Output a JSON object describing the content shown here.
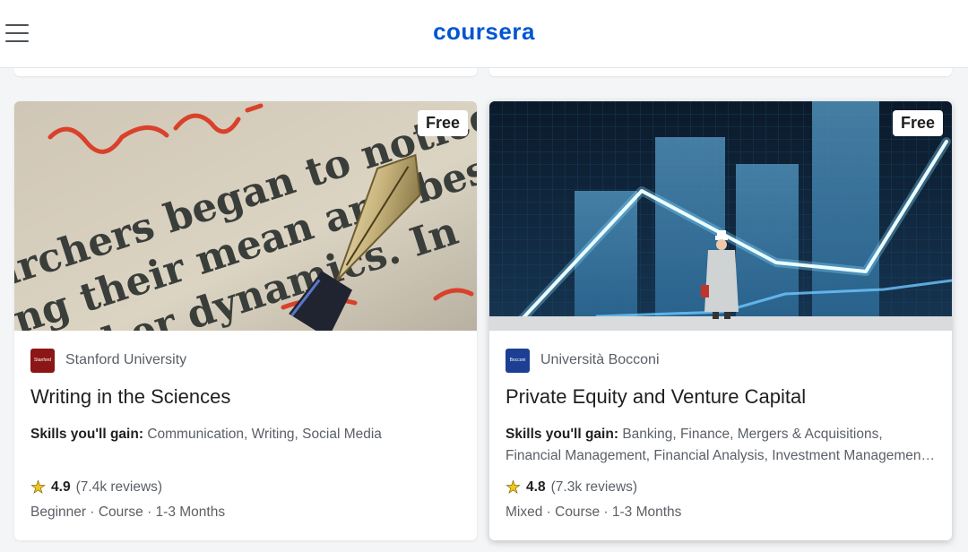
{
  "header": {
    "logo_text": "coursera",
    "menu_icon": "hamburger-menu-icon",
    "brand_color": "#0056d2"
  },
  "cards": [
    {
      "badge": "Free",
      "partner": "Stanford University",
      "partner_logo_text": "Stanford",
      "title": "Writing in the Sciences",
      "skills_label": "Skills you'll gain:",
      "skills": "Communication, Writing, Social Media",
      "rating": "4.9",
      "reviews": "(7.4k reviews)",
      "details": "Beginner · Course · 1-3 Months"
    },
    {
      "badge": "Free",
      "partner": "Università Bocconi",
      "partner_logo_text": "Bocconi",
      "title": "Private Equity and Venture Capital",
      "skills_label": "Skills you'll gain:",
      "skills": "Banking, Finance, Mergers & Acquisitions, Financial Management, Financial Analysis, Investment Managemen…",
      "rating": "4.8",
      "reviews": "(7.3k reviews)",
      "details": "Mixed · Course · 1-3 Months"
    }
  ]
}
